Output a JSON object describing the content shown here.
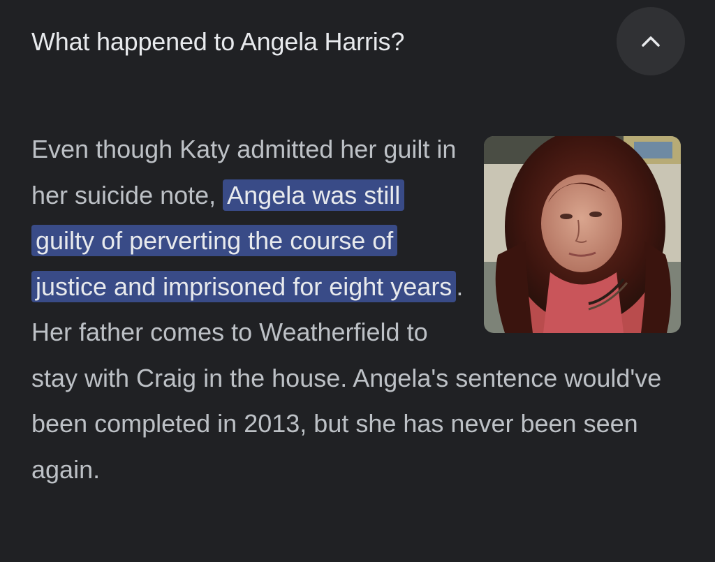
{
  "header": {
    "question": "What happened to Angela Harris?",
    "collapse_icon": "chevron-up-icon"
  },
  "answer": {
    "text_before": "Even though Katy admitted her guilt in her suicide note, ",
    "highlight": "Angela was still guilty of perverting the course of justice and imprisoned for eight years",
    "text_after_highlight": ".",
    "text_rest": "Her father comes to Weatherfield to stay with Craig in the house. Angela's sentence would've been completed in 2013, but she has never been seen again.",
    "image_alt": "Photo of a woman with long curly dark red hair"
  },
  "colors": {
    "background": "#202124",
    "highlight": "#394b87",
    "button": "#303134"
  }
}
